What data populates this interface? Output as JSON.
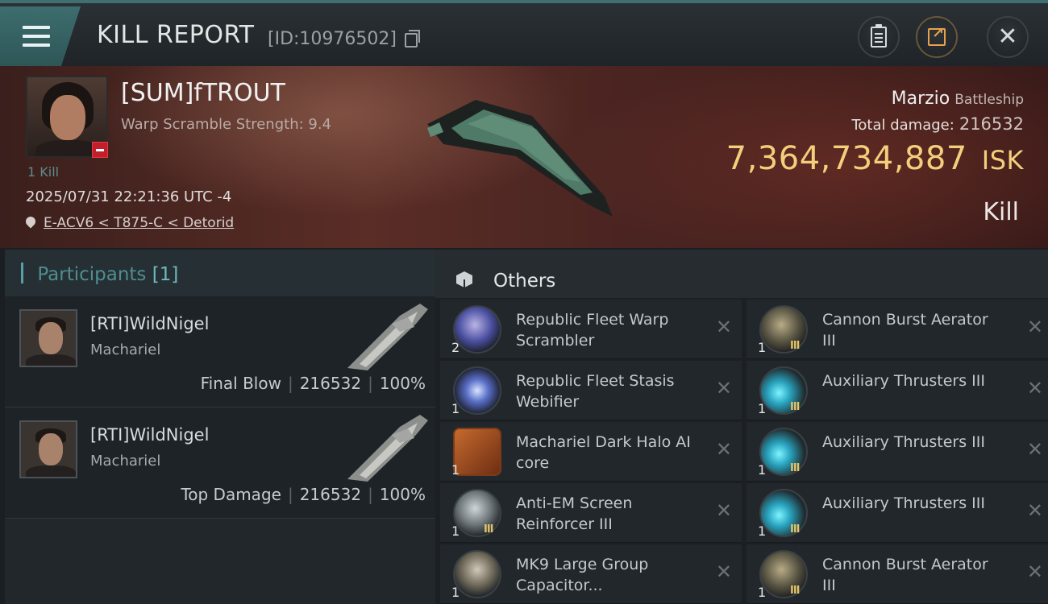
{
  "header": {
    "title": "KILL REPORT",
    "report_id": "[ID:10976502]",
    "buttons": {
      "menu": "menu-icon",
      "clipboard": "clipboard-icon",
      "share": "share-icon",
      "close": "close-icon"
    }
  },
  "victim": {
    "name": "[SUM]fTROUT",
    "warp_scramble": "Warp Scramble Strength: 9.4",
    "kill_count": "1 Kill",
    "datetime": "2025/07/31 22:21:36 UTC -4",
    "location": "E-ACV6 < T875-C < Detorid",
    "ship_name": "Marzio",
    "ship_class": "Battleship",
    "total_damage_label": "Total damage:",
    "total_damage": "216532",
    "isk_value": "7,364,734,887",
    "isk_unit": "ISK",
    "result": "Kill"
  },
  "participants": {
    "label": "Participants",
    "count": "[1]",
    "rows": [
      {
        "name": "[RTI]WildNigel",
        "ship": "Machariel",
        "role": "Final Blow",
        "damage": "216532",
        "percent": "100%"
      },
      {
        "name": "[RTI]WildNigel",
        "ship": "Machariel",
        "role": "Top Damage",
        "damage": "216532",
        "percent": "100%"
      }
    ]
  },
  "others": {
    "label": "Others",
    "items": [
      {
        "name": "Republic Fleet Warp Scrambler",
        "qty": "2",
        "tier": "",
        "icon": "scrambler"
      },
      {
        "name": "Cannon Burst Aerator III",
        "qty": "1",
        "tier": "III",
        "icon": "cannon"
      },
      {
        "name": "Republic Fleet Stasis Webifier",
        "qty": "1",
        "tier": "",
        "icon": "webifier"
      },
      {
        "name": "Auxiliary Thrusters III",
        "qty": "1",
        "tier": "III",
        "icon": "thruster"
      },
      {
        "name": "Machariel Dark Halo AI core",
        "qty": "1",
        "tier": "",
        "icon": "aicore"
      },
      {
        "name": "Auxiliary Thrusters III",
        "qty": "1",
        "tier": "III",
        "icon": "thruster"
      },
      {
        "name": "Anti-EM Screen Reinforcer III",
        "qty": "1",
        "tier": "III",
        "icon": "shield"
      },
      {
        "name": "Auxiliary Thrusters III",
        "qty": "1",
        "tier": "III",
        "icon": "thruster"
      },
      {
        "name": "MK9 Large Group Capacitor...",
        "qty": "1",
        "tier": "",
        "icon": "capacitor"
      },
      {
        "name": "Cannon Burst Aerator III",
        "qty": "1",
        "tier": "III",
        "icon": "cannon"
      }
    ],
    "remove_glyph": "✕"
  },
  "colors": {
    "accent": "#3f6f70",
    "isk": "#f3cf7c",
    "participants_label": "#4f8d90"
  }
}
